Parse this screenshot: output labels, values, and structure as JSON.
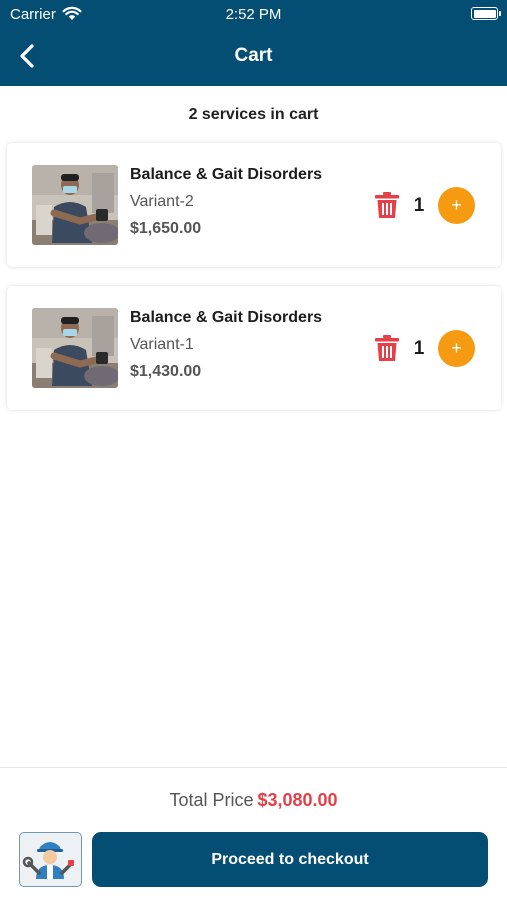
{
  "status_bar": {
    "carrier": "Carrier",
    "time": "2:52 PM"
  },
  "header": {
    "title": "Cart",
    "back_icon": "chevron-left-icon"
  },
  "cart": {
    "summary": "2 services in cart",
    "items": [
      {
        "name": "Balance & Gait Disorders",
        "variant": "Variant-2",
        "price": "$1,650.00",
        "quantity": "1"
      },
      {
        "name": "Balance & Gait Disorders",
        "variant": "Variant-1",
        "price": "$1,430.00",
        "quantity": "1"
      }
    ],
    "delete_icon": "trash-icon",
    "plus_symbol": "+"
  },
  "footer": {
    "total_label": "Total Price",
    "total_value": "$3,080.00",
    "checkout_label": "Proceed to checkout",
    "avatar_icon": "technician-icon"
  },
  "colors": {
    "primary": "#054e73",
    "accent": "#f59a11",
    "price_highlight": "#e53f48",
    "delete": "#e53f48"
  }
}
